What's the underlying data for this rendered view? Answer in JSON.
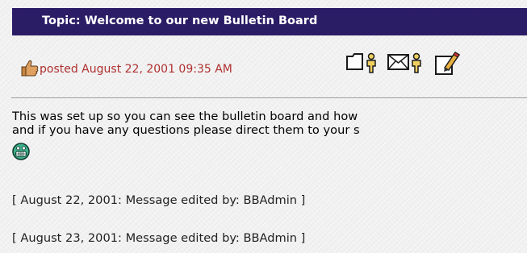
{
  "topic": {
    "title": "Topic: Welcome to our new Bulletin Board"
  },
  "post": {
    "posted": "posted August 22, 2001 09:35 AM",
    "icons": [
      "thumbs-up-icon",
      "profile-icon",
      "email-icon",
      "edit-icon"
    ],
    "body_line1": "This was set up so you can see the bulletin board and how",
    "body_line2": "and if you have any questions please direct them to your s",
    "smiley": "grin-icon",
    "edits": [
      "[ August 22, 2001: Message edited by: BBAdmin ]",
      "[ August 23, 2001: Message edited by: BBAdmin ]"
    ]
  },
  "colors": {
    "title_bar": "#2b1c66",
    "posted_text": "#b03030",
    "background": "#f1f1f1"
  }
}
